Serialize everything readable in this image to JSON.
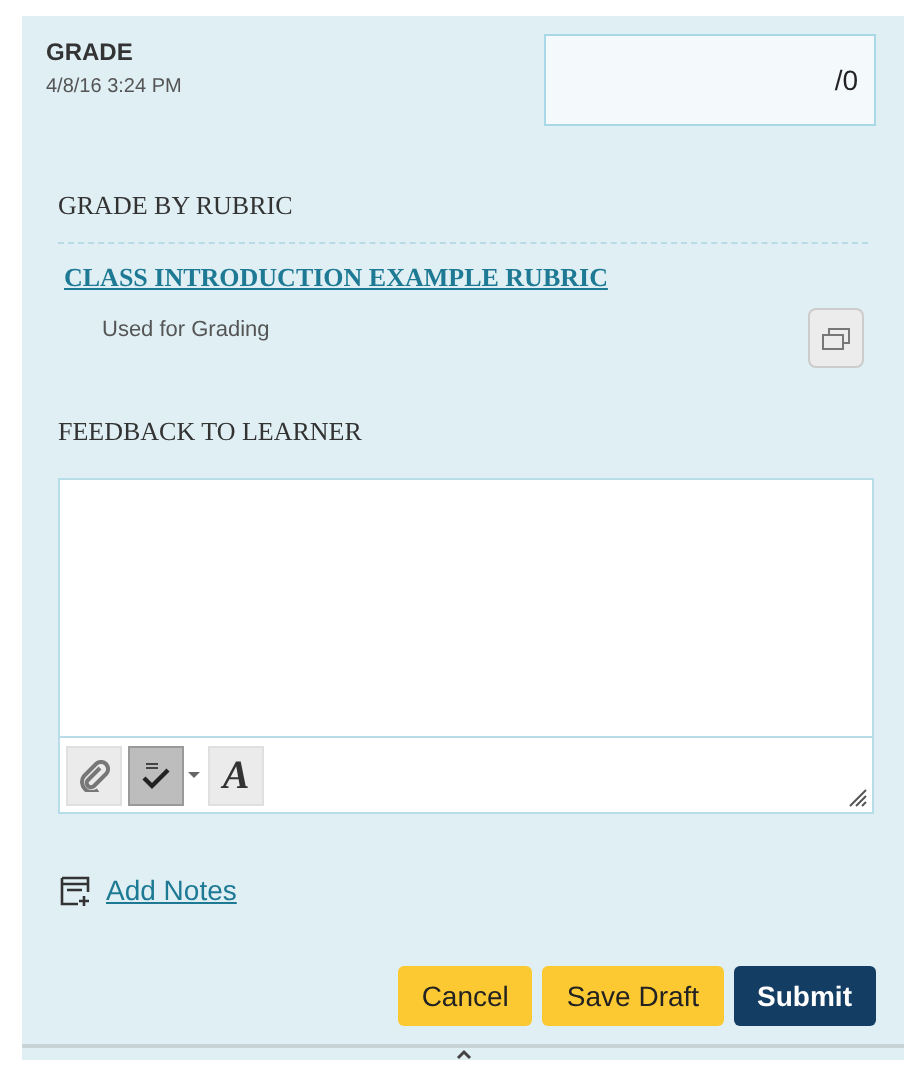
{
  "grade": {
    "label": "GRADE",
    "date": "4/8/16 3:24 PM",
    "value": "/0"
  },
  "rubric": {
    "heading": "GRADE BY RUBRIC",
    "link": "CLASS INTRODUCTION EXAMPLE RUBRIC",
    "usage": "Used for Grading"
  },
  "feedback": {
    "heading": "FEEDBACK TO LEARNER",
    "toolbar": [
      {
        "kind": "attach",
        "pressed": false
      },
      {
        "kind": "spellcheck",
        "pressed": true
      },
      {
        "kind": "font",
        "label": "A",
        "pressed": false
      }
    ]
  },
  "add_notes": "Add Notes",
  "buttons": [
    {
      "label": "Cancel",
      "kind": "secondary"
    },
    {
      "label": "Save Draft",
      "kind": "secondary"
    },
    {
      "label": "Submit",
      "kind": "primary"
    }
  ]
}
